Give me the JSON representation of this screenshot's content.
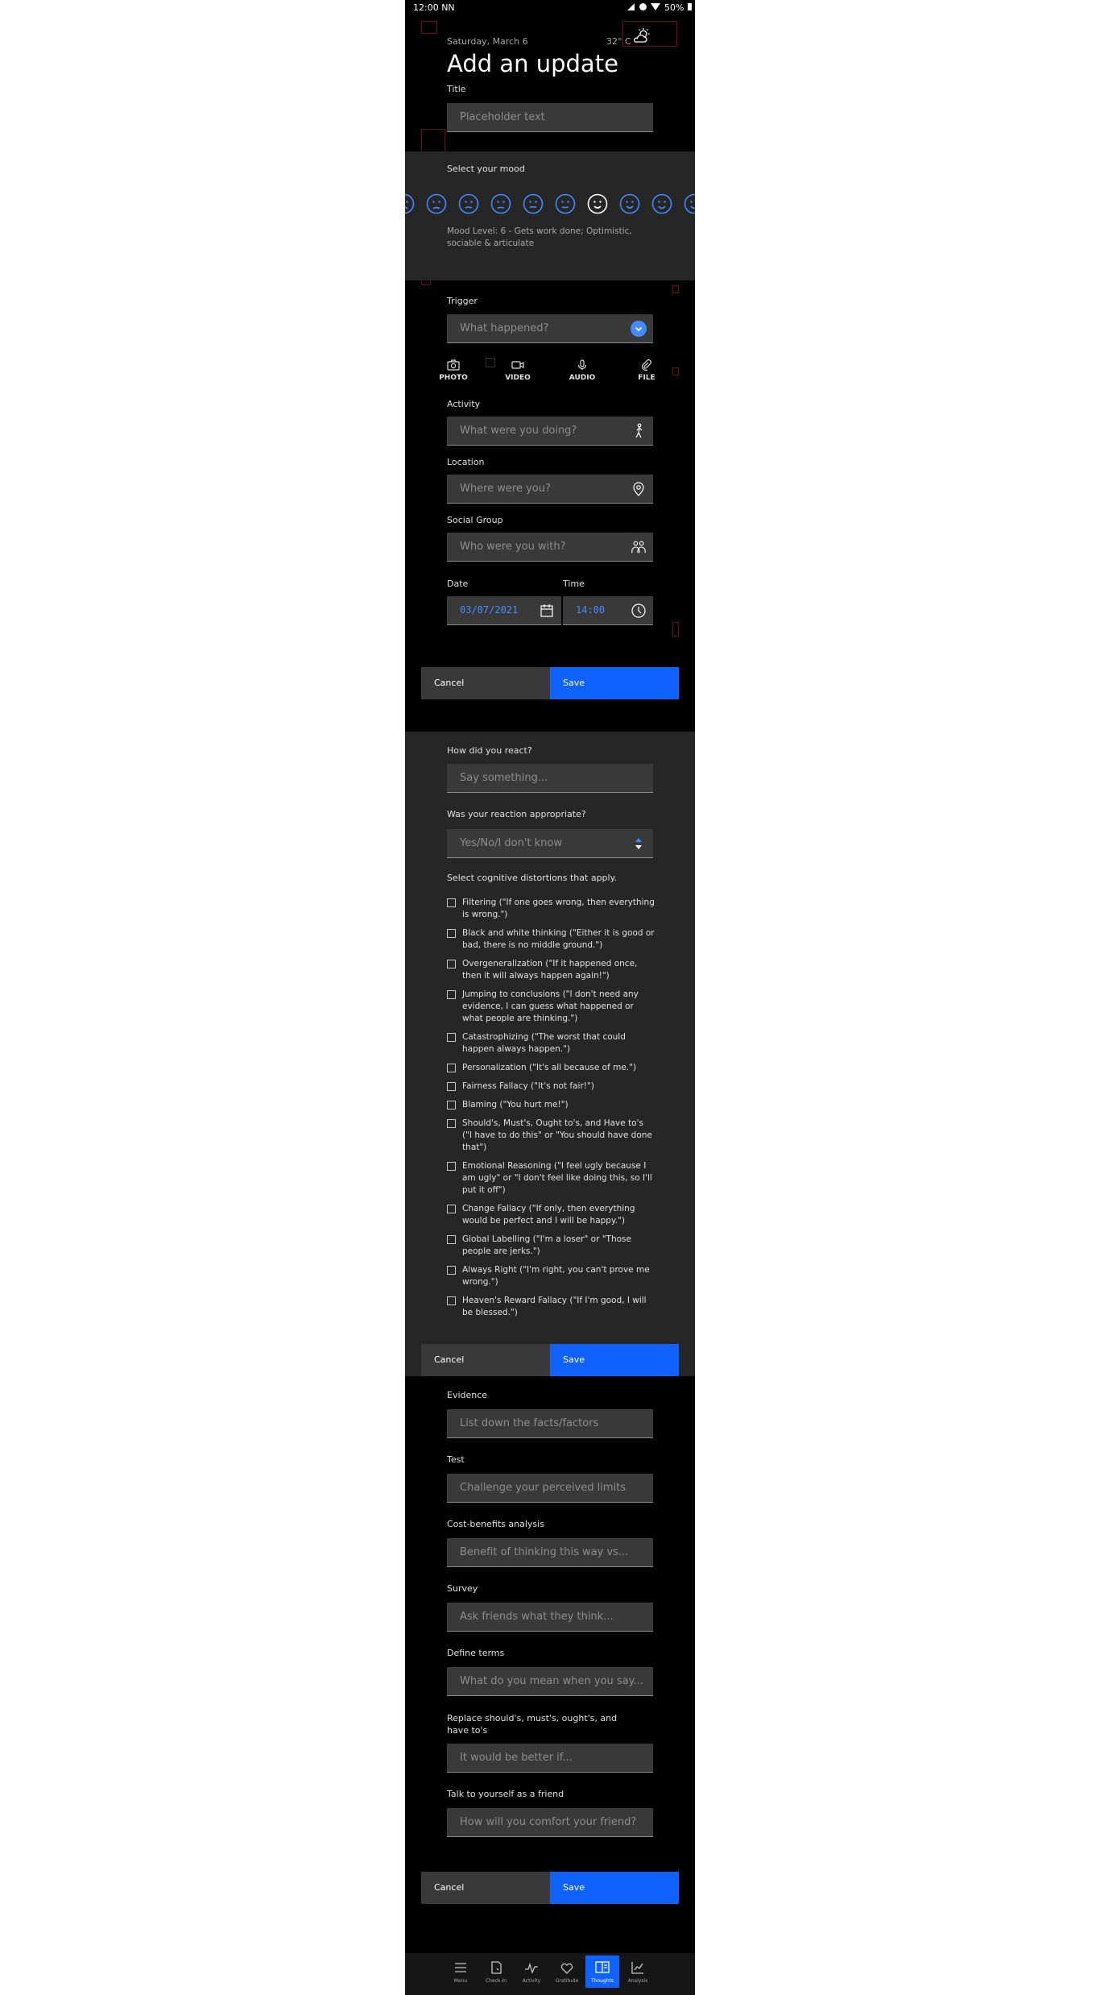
{
  "status_bar": {
    "time": "12:00 NN",
    "battery": "50%"
  },
  "header": {
    "date": "Saturday, March 6",
    "temperature": "32° C",
    "weather_icon": "partly-cloudy-icon",
    "title": "Add an update"
  },
  "title_field": {
    "label": "Title",
    "placeholder": "Placeholder text"
  },
  "mood": {
    "label": "Select your mood",
    "selected_index": 6,
    "level_text": "Mood Level: 6 - Gets work done; Optimistic, sociable & articulate"
  },
  "trigger": {
    "label": "Trigger",
    "placeholder": "What happened?"
  },
  "media": {
    "photo": "PHOTO",
    "video": "VIDEO",
    "audio": "AUDIO",
    "file": "FILE"
  },
  "activity": {
    "label": "Activity",
    "placeholder": "What were you doing?"
  },
  "location": {
    "label": "Location",
    "placeholder": "Where were you?"
  },
  "social": {
    "label": "Social Group",
    "placeholder": "Who were you with?"
  },
  "date": {
    "label": "Date",
    "value": "03/07/2021"
  },
  "time": {
    "label": "Time",
    "value": "14:00"
  },
  "buttons": {
    "cancel": "Cancel",
    "save": "Save"
  },
  "reaction": {
    "label": "How did you react?",
    "placeholder": "Say something..."
  },
  "appropriate": {
    "label": "Was your reaction appropriate?",
    "selected": "Yes/No/I don't know"
  },
  "distortions": {
    "label": "Select cognitive distortions that apply.",
    "items": [
      "Filtering (\"If one goes wrong, then everything is wrong.\")",
      "Black and white thinking (\"Either it is good or bad, there is no middle ground.\")",
      "Overgeneralization (\"If it happened once, then it will always happen again!\")",
      "Jumping to conclusions (\"I don't need any evidence, I can guess what happened or what people are thinking.\")",
      "Catastrophizing (\"The worst that could happen always happen.\")",
      "Personalization (\"It's all because of me.\")",
      "Fairness Fallacy (\"It's not fair!\")",
      "Blaming (\"You hurt me!\")",
      "Should's, Must's, Ought to's, and Have to's (\"I have to do this\" or \"You should have done that\")",
      "Emotional Reasoning (\"I feel ugly because I am ugly\" or \"I don't feel like doing this, so I'll put it off\")",
      "Change Fallacy (\"If only, then everything would be perfect and I will be happy.\")",
      "Global Labelling (\"I'm a loser\" or \"Those people are jerks.\")",
      "Always Right (\"I'm right, you can't prove me wrong.\")",
      "Heaven's Reward Fallacy (\"If I'm good, I will be blessed.\")"
    ]
  },
  "evidence": {
    "label": "Evidence",
    "placeholder": "List down the facts/factors"
  },
  "test": {
    "label": "Test",
    "placeholder": "Challenge your perceived limits"
  },
  "cost_benefit": {
    "label": "Cost-benefits analysis",
    "placeholder": "Benefit of thinking this way vs..."
  },
  "survey": {
    "label": "Survey",
    "placeholder": "Ask friends what they think..."
  },
  "define_terms": {
    "label": "Define terms",
    "placeholder": "What do you mean when you say..."
  },
  "replace_shoulds": {
    "label": "Replace should's, must's, ought's, and have to's",
    "placeholder": "It would be better if..."
  },
  "talk_friend": {
    "label": "Talk to yourself as a friend",
    "placeholder": "How will you comfort your friend?"
  },
  "bottom_nav": {
    "active_index": 4,
    "items": [
      "Menu",
      "Check-In",
      "Activity",
      "Gratitude",
      "Thoughts",
      "Analysis"
    ]
  },
  "colors": {
    "primary": "#0f62fe",
    "background": "#000000",
    "section_bg": "#262626",
    "field_bg": "#393939"
  }
}
